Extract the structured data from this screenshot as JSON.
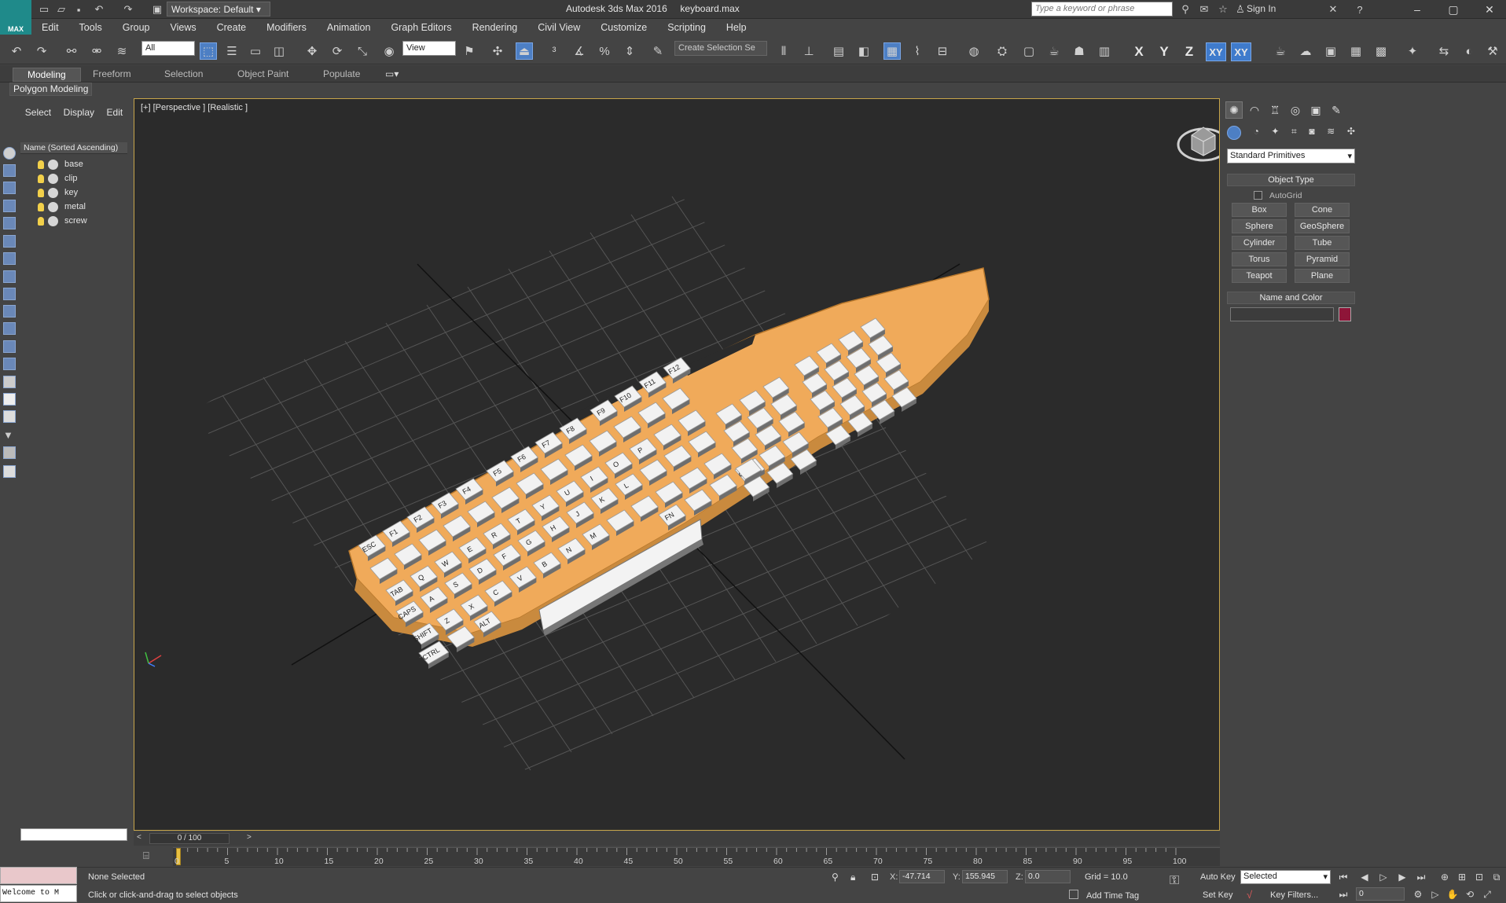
{
  "titlebar": {
    "logo_text": "MAX",
    "workspace": "Workspace: Default",
    "app_title": "Autodesk 3ds Max 2016",
    "file_name": "keyboard.max",
    "search_placeholder": "Type a keyword or phrase",
    "sign_in": "Sign In"
  },
  "menu": [
    "Edit",
    "Tools",
    "Group",
    "Views",
    "Create",
    "Modifiers",
    "Animation",
    "Graph Editors",
    "Rendering",
    "Civil View",
    "Customize",
    "Scripting",
    "Help"
  ],
  "toolbar": {
    "selection_filter": "All",
    "ref_coord": "View",
    "named_selection": "Create Selection Se",
    "axes": [
      "X",
      "Y",
      "Z",
      "XY",
      "XY"
    ]
  },
  "ribbon": {
    "tabs": [
      "Modeling",
      "Freeform",
      "Selection",
      "Object Paint",
      "Populate"
    ],
    "sub_label": "Polygon Modeling"
  },
  "scene_explorer": {
    "tabs": [
      "Select",
      "Display",
      "Edit"
    ],
    "header": "Name (Sorted Ascending)",
    "objects": [
      "base",
      "clip",
      "key",
      "metal",
      "screw"
    ]
  },
  "viewport": {
    "label": "[+] [Perspective ] [Realistic ]"
  },
  "keyboard_legends": {
    "row_fn": [
      "ESC",
      "F1",
      "F2",
      "F3",
      "F4",
      "F5",
      "F6",
      "F7",
      "F8",
      "F9",
      "F10",
      "F11",
      "F12"
    ],
    "mods": [
      "TAB",
      "CAPS",
      "SHIFT",
      "CTRL",
      "ALT",
      "FN",
      "CTRL",
      "SHIFT"
    ],
    "letters": [
      "Q",
      "W",
      "E",
      "R",
      "T",
      "Y",
      "U",
      "I",
      "O",
      "P",
      "A",
      "S",
      "D",
      "F",
      "G",
      "H",
      "J",
      "K",
      "L",
      "Z",
      "X",
      "C",
      "V",
      "B",
      "N",
      "M"
    ]
  },
  "command_panel": {
    "category": "Standard Primitives",
    "object_type_title": "Object Type",
    "autogrid": "AutoGrid",
    "primitives": [
      "Box",
      "Cone",
      "Sphere",
      "GeoSphere",
      "Cylinder",
      "Tube",
      "Torus",
      "Pyramid",
      "Teapot",
      "Plane"
    ],
    "name_color_title": "Name and Color",
    "object_color": "#8e1538"
  },
  "timeline": {
    "slider": "0 / 100",
    "ticks": [
      "0",
      "5",
      "10",
      "15",
      "20",
      "25",
      "30",
      "35",
      "40",
      "45",
      "50",
      "55",
      "60",
      "65",
      "70",
      "75",
      "80",
      "85",
      "90",
      "95",
      "100"
    ]
  },
  "status": {
    "script_welcome": "Welcome to M",
    "selection": "None Selected",
    "prompt": "Click or click-and-drag to select objects",
    "x_label": "X:",
    "x": "-47.714",
    "y_label": "Y:",
    "y": "155.945",
    "z_label": "Z:",
    "z": "0.0",
    "grid": "Grid = 10.0",
    "add_time_tag": "Add Time Tag",
    "auto_key": "Auto Key",
    "set_key": "Set Key",
    "key_mode": "Selected",
    "key_filters": "Key Filters...",
    "frame": "0"
  },
  "colors": {
    "viewport_border": "#c7a54a",
    "keyboard_base": "#f0aa5a",
    "active_blue": "#4d7fc4"
  }
}
